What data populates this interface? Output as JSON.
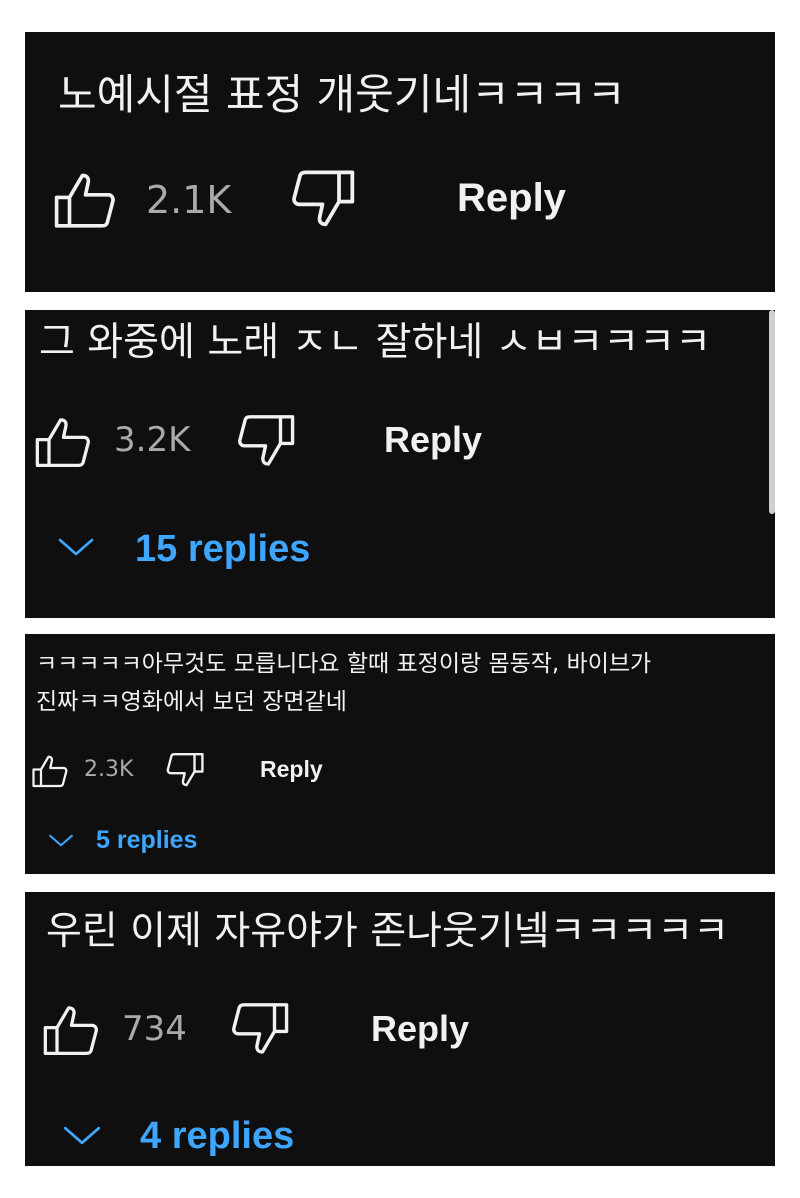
{
  "comments": [
    {
      "text": "노예시절 표정 개웃기네ㅋㅋㅋㅋ",
      "likes": "2.1K",
      "reply_label": "Reply",
      "replies_label": ""
    },
    {
      "text": "그 와중에 노래 ㅈㄴ 잘하네 ㅅㅂㅋㅋㅋㅋ",
      "likes": "3.2K",
      "reply_label": "Reply",
      "replies_label": "15 replies"
    },
    {
      "text_lines": [
        "ㅋㅋㅋㅋㅋ아무것도 모릅니다요 할때 표정이랑 몸동작, 바이브가",
        "진짜ㅋㅋ영화에서 보던 장면같네"
      ],
      "likes": "2.3K",
      "reply_label": "Reply",
      "replies_label": "5 replies"
    },
    {
      "text": "우린 이제 자유야가 존나웃기넼ㅋㅋㅋㅋㅋ",
      "likes": "734",
      "reply_label": "Reply",
      "replies_label": "4 replies"
    }
  ],
  "icons": {
    "like": "thumbs-up-icon",
    "dislike": "thumbs-down-icon",
    "expand": "chevron-down-icon"
  },
  "colors": {
    "card_bg": "#0f0f0f",
    "text": "#f1f1f1",
    "count": "#aaaaaa",
    "link_blue": "#3ea6ff"
  }
}
